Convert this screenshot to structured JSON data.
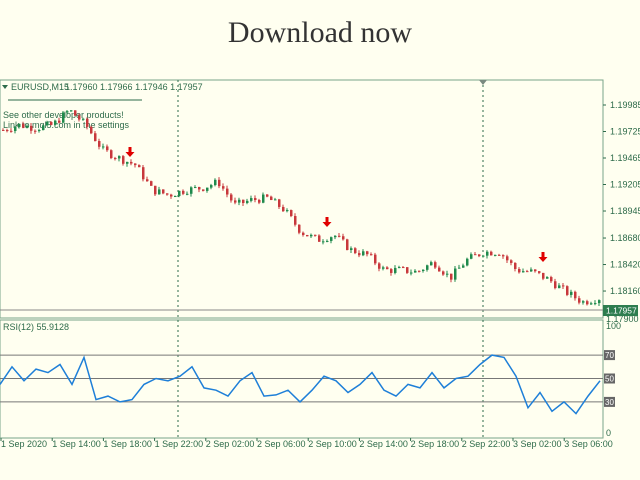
{
  "banner": "Download now",
  "header": {
    "symbol": "EURUSD,M15",
    "ohlc": "1.17960 1.17966 1.17946 1.17957",
    "note1": "See other developer products!",
    "note2": "Link to mql5.com in the settings"
  },
  "price_axis": [
    "1.19985",
    "1.19725",
    "1.19465",
    "1.19205",
    "1.18945",
    "1.18680",
    "1.18420",
    "1.18160"
  ],
  "current_price": "1.17957",
  "hidden_level": "1.17900",
  "rsi": {
    "label": "RSI(12) 55.9128",
    "levels": [
      "70",
      "50",
      "30"
    ],
    "max": "100",
    "min": "0"
  },
  "time_axis": [
    "1 Sep 2020",
    "1 Sep 14:00",
    "1 Sep 18:00",
    "1 Sep 22:00",
    "2 Sep 02:00",
    "2 Sep 06:00",
    "2 Sep 10:00",
    "2 Sep 14:00",
    "2 Sep 18:00",
    "2 Sep 22:00",
    "3 Sep 02:00",
    "3 Sep 06:00"
  ],
  "price_path": [
    1.1974,
    1.19789,
    1.19759,
    1.19789,
    1.19936,
    1.19789,
    1.19544,
    1.19465,
    1.19396,
    1.19151,
    1.19102,
    1.19151,
    1.19171,
    1.1923,
    1.19004,
    1.19053,
    1.19073,
    1.18955,
    1.18739,
    1.18661,
    1.1871,
    1.18563,
    1.18514,
    1.18366,
    1.18366,
    1.18347,
    1.18445,
    1.18288,
    1.18464,
    1.18543,
    1.18543,
    1.18366,
    1.18347,
    1.18268,
    1.1815,
    1.18052,
    1.18091
  ],
  "rsi_path": [
    45,
    60,
    48,
    58,
    55,
    62,
    45,
    68,
    32,
    35,
    30,
    32,
    45,
    50,
    48,
    52,
    60,
    42,
    40,
    35,
    48,
    55,
    35,
    36,
    40,
    30,
    40,
    52,
    48,
    38,
    45,
    55,
    40,
    35,
    45,
    42,
    55,
    42,
    50,
    52,
    62,
    70,
    68,
    52,
    25,
    38,
    22,
    30,
    20,
    35,
    48
  ],
  "sell_signals": [
    1.19396,
    1.1871,
    1.18366
  ],
  "colors": {
    "bull": "#1f8a4c",
    "bear": "#c8383c",
    "rsi": "#1e7fd8",
    "arrow": "#e00000",
    "axis": "#2e6b4a"
  }
}
